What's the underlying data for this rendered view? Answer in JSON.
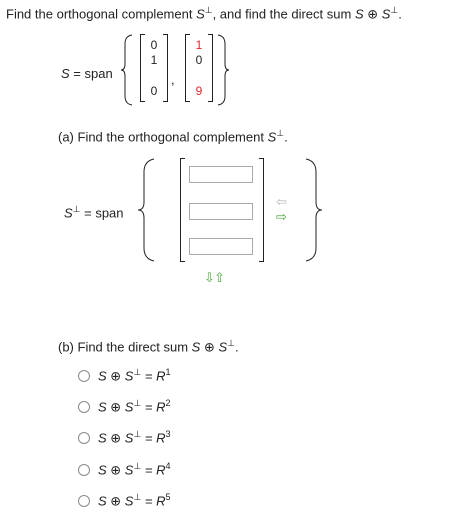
{
  "question": {
    "title_prefix": "Find the orthogonal complement ",
    "S_perp": "S",
    "perp_sup": "⊥",
    "title_mid": ", and find the direct sum ",
    "S": "S",
    "oplus": " ⊕ ",
    "end": "."
  },
  "span_def": {
    "label_S": "S",
    "eq_span": " = span",
    "vector1": [
      "0",
      "1",
      "",
      "0"
    ],
    "vector2": [
      "1",
      "0",
      "",
      "9"
    ],
    "vector2_red_rows": [
      0,
      3
    ],
    "comma": ","
  },
  "part_a": {
    "prefix": "(a) Find the orthogonal complement ",
    "S": "S",
    "perp": "⊥",
    "end": ".",
    "label_S": "S",
    "label_perp": "⊥",
    "eq_span": " = span",
    "inputs": [
      "",
      "",
      ""
    ],
    "right_arrow": "⇨",
    "left_arrow": "⇦",
    "down_arrow": "⇩",
    "up_arrow": "⇧"
  },
  "part_b": {
    "prefix": "(b) Find the direct sum ",
    "S": "S",
    "oplus": " ⊕ ",
    "S2": "S",
    "perp": "⊥",
    "end": ".",
    "options": [
      {
        "lhs": "S ⊕ S",
        "sup": "⊥",
        "eq": " = R",
        "pow": "1"
      },
      {
        "lhs": "S ⊕ S",
        "sup": "⊥",
        "eq": " = R",
        "pow": "2"
      },
      {
        "lhs": "S ⊕ S",
        "sup": "⊥",
        "eq": " = R",
        "pow": "3"
      },
      {
        "lhs": "S ⊕ S",
        "sup": "⊥",
        "eq": " = R",
        "pow": "4"
      },
      {
        "lhs": "S ⊕ S",
        "sup": "⊥",
        "eq": " = R",
        "pow": "5"
      }
    ]
  },
  "colors": {
    "red": "#e0262d",
    "arrow_gray": "#b8b8b8",
    "arrow_green": "#4aa83a"
  }
}
